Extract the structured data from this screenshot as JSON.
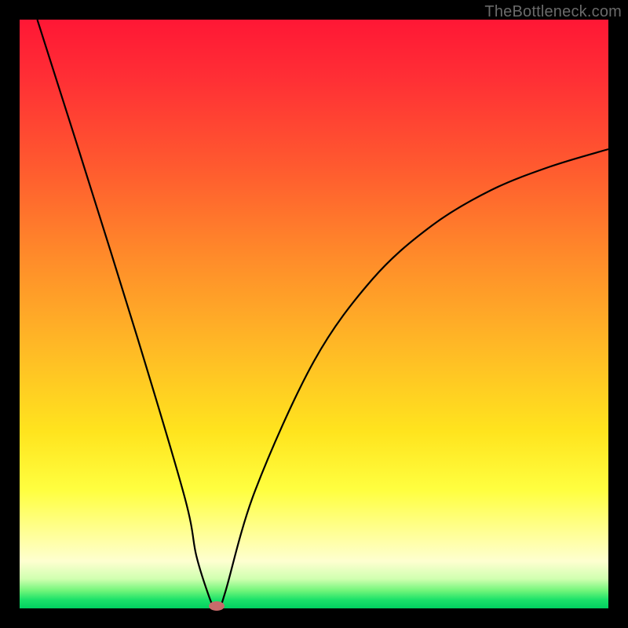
{
  "watermark": "TheBottleneck.com",
  "chart_data": {
    "type": "line",
    "title": "",
    "xlabel": "",
    "ylabel": "",
    "xlim": [
      0,
      100
    ],
    "ylim": [
      0,
      100
    ],
    "series": [
      {
        "name": "bottleneck-curve",
        "x": [
          3,
          10,
          20,
          28,
          30,
          32,
          33,
          34,
          35,
          40,
          50,
          60,
          70,
          80,
          90,
          100
        ],
        "y": [
          100,
          78,
          46,
          19,
          9,
          2.5,
          0.3,
          0.3,
          3,
          20,
          42,
          56,
          65,
          71,
          75,
          78
        ]
      }
    ],
    "marker": {
      "x": 33.5,
      "y": 0.4,
      "color": "#c86b6b"
    },
    "gradient_stops": [
      {
        "pct": 0,
        "color": "#ff1735"
      },
      {
        "pct": 40,
        "color": "#ff8a2a"
      },
      {
        "pct": 70,
        "color": "#ffe41e"
      },
      {
        "pct": 92,
        "color": "#feffd0"
      },
      {
        "pct": 100,
        "color": "#00d060"
      }
    ]
  },
  "layout": {
    "canvas_size": 800,
    "plot_margin": 25
  }
}
